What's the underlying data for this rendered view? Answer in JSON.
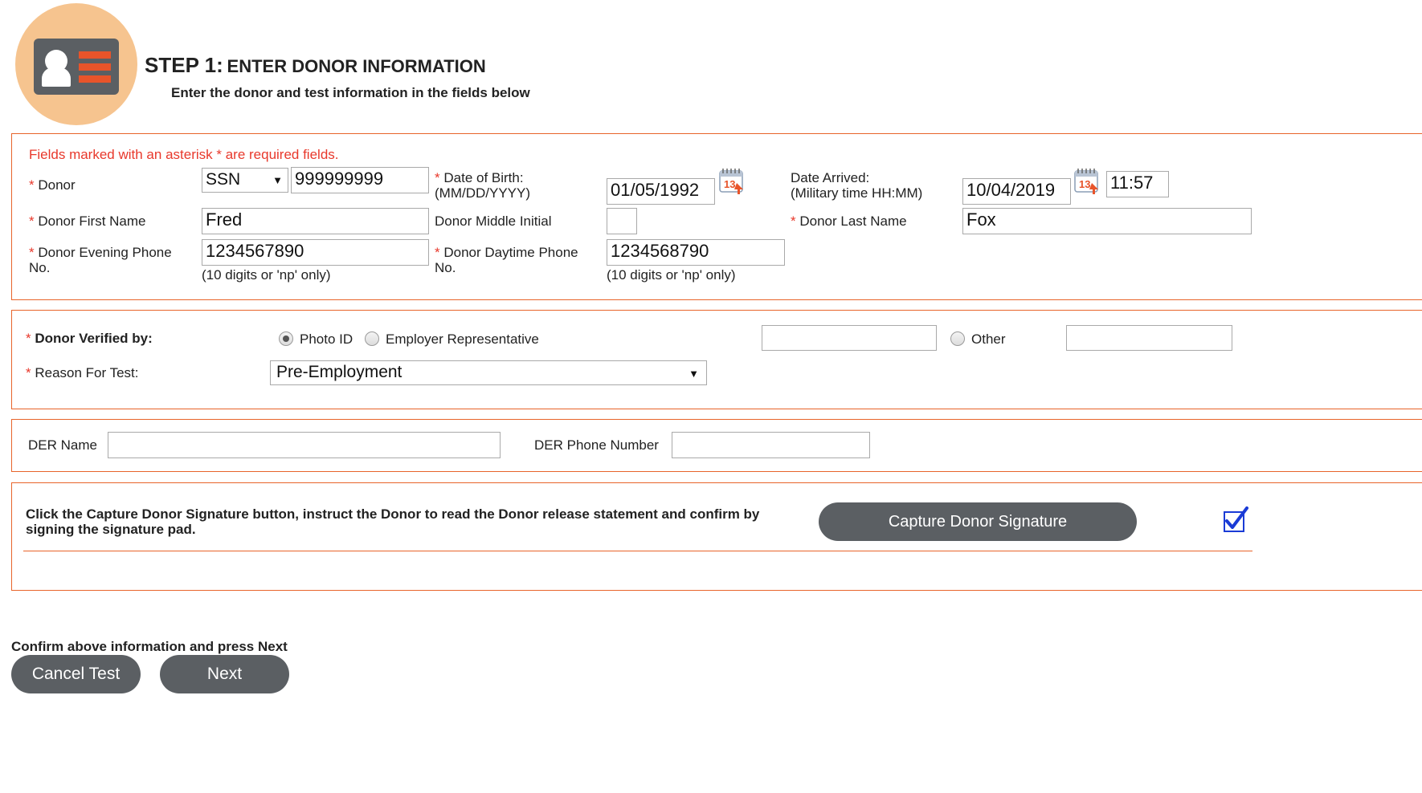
{
  "header": {
    "step": "STEP 1:",
    "title": "ENTER DONOR INFORMATION",
    "subtitle": "Enter the donor and test information in the fields below",
    "icon": "donor-id-card-icon",
    "colors": {
      "circle": "#f6c48f",
      "card": "#5b5f63",
      "stripes": "#e8542a"
    }
  },
  "donor_panel": {
    "required_note": "Fields marked with an asterisk * are required fields.",
    "asterisk": "*",
    "donor_label": "Donor",
    "id_type": "SSN",
    "id_value": "999999999",
    "dob_label": "Date of Birth:",
    "dob_format": "(MM/DD/YYYY)",
    "dob_value": "01/05/1992",
    "date_arrived_label": "Date Arrived:",
    "date_arrived_format": "(Military time HH:MM)",
    "date_arrived_value": "10/04/2019",
    "time_value": "11:57",
    "first_name_label": "Donor First Name",
    "first_name_value": "Fred",
    "middle_initial_label": "Donor Middle Initial",
    "middle_initial_value": "",
    "last_name_label": "Donor Last Name",
    "last_name_value": "Fox",
    "evening_phone_label": "Donor Evening Phone",
    "evening_phone_label2": "No.",
    "evening_phone_value": "1234567890",
    "daytime_phone_label": "Donor Daytime Phone",
    "daytime_phone_label2": "No.",
    "daytime_phone_value": "1234568790",
    "phone_hint": "(10 digits or 'np' only)"
  },
  "verify_panel": {
    "verified_label": "Donor Verified by:",
    "option_photo_id": "Photo ID",
    "option_employer": "Employer Representative",
    "option_other": "Other",
    "employer_value": "",
    "other_value": "",
    "selected": "Photo ID",
    "reason_label": "Reason For Test:",
    "reason_value": "Pre-Employment"
  },
  "der_panel": {
    "name_label": "DER Name",
    "name_value": "",
    "phone_label": "DER Phone Number",
    "phone_value": ""
  },
  "signature_panel": {
    "instructions": "Click the Capture Donor Signature button, instruct the Donor to read the Donor release statement and confirm by signing the signature pad.",
    "capture_button": "Capture Donor Signature",
    "captured": true,
    "check_color": "#1a3bd6"
  },
  "footer": {
    "confirm_text": "Confirm above information and press Next",
    "cancel_button": "Cancel Test",
    "next_button": "Next"
  },
  "accent_color": "#e8642a"
}
